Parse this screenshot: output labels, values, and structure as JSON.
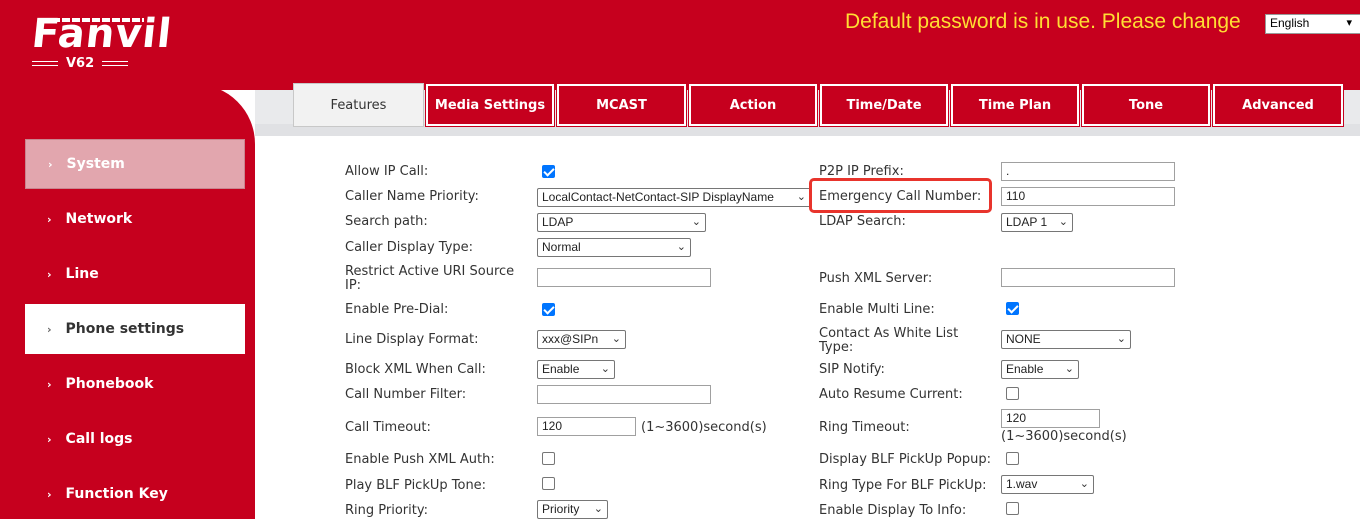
{
  "header": {
    "brand": "Fanvil",
    "model": "V62",
    "warning": "Default password is in use. Please change",
    "language": "English",
    "colors": {
      "brand_red": "#c6001e",
      "warning_yellow": "#ffde33"
    }
  },
  "sidebar": {
    "items": [
      {
        "label": "System",
        "icon": "chevron-right-icon"
      },
      {
        "label": "Network",
        "icon": "chevron-right-icon"
      },
      {
        "label": "Line",
        "icon": "chevron-right-icon"
      },
      {
        "label": "Phone settings",
        "icon": "chevron-right-icon"
      },
      {
        "label": "Phonebook",
        "icon": "chevron-right-icon"
      },
      {
        "label": "Call logs",
        "icon": "chevron-right-icon"
      },
      {
        "label": "Function Key",
        "icon": "chevron-right-icon"
      }
    ]
  },
  "tabs": [
    {
      "label": "Features",
      "active": true
    },
    {
      "label": "Media Settings"
    },
    {
      "label": "MCAST"
    },
    {
      "label": "Action"
    },
    {
      "label": "Time/Date"
    },
    {
      "label": "Time Plan"
    },
    {
      "label": "Tone"
    },
    {
      "label": "Advanced"
    }
  ],
  "left": {
    "allow_ip_call": {
      "label": "Allow IP Call:",
      "checked": true
    },
    "caller_name_priority": {
      "label": "Caller Name Priority:",
      "value": "LocalContact-NetContact-SIP DisplayName"
    },
    "search_path": {
      "label": "Search path:",
      "value": "LDAP"
    },
    "caller_display_type": {
      "label": "Caller Display Type:",
      "value": "Normal"
    },
    "restrict_uri_1": "Restrict Active URI Source",
    "restrict_uri_2": "IP:",
    "restrict_uri_value": "",
    "enable_pre_dial": {
      "label": "Enable Pre-Dial:",
      "checked": true
    },
    "line_display_format": {
      "label": "Line Display Format:",
      "value": "xxx@SIPn"
    },
    "block_xml": {
      "label": "Block XML When Call:",
      "value": "Enable"
    },
    "call_number_filter": {
      "label": "Call Number Filter:",
      "value": ""
    },
    "call_timeout": {
      "label": "Call Timeout:",
      "value": "120",
      "unit": "(1~3600)second(s)"
    },
    "push_xml_auth": {
      "label": "Enable Push XML Auth:",
      "checked": false
    },
    "blf_pickup_tone": {
      "label": "Play BLF PickUp Tone:",
      "checked": false
    },
    "ring_priority": {
      "label": "Ring Priority:",
      "value": "Priority"
    }
  },
  "right": {
    "p2p_ip_prefix": {
      "label": "P2P IP Prefix:",
      "value": "."
    },
    "emergency_call_number": {
      "label": "Emergency Call Number:",
      "value": "110"
    },
    "ldap_search": {
      "label": "LDAP Search:",
      "value": "LDAP 1"
    },
    "push_xml_server": {
      "label": "Push XML Server:",
      "value": ""
    },
    "enable_multi_line": {
      "label": "Enable Multi Line:",
      "checked": true
    },
    "contact_white_list_1": "Contact As White List",
    "contact_white_list_2": "Type:",
    "contact_white_list_value": "NONE",
    "sip_notify": {
      "label": "SIP Notify:",
      "value": "Enable"
    },
    "auto_resume": {
      "label": "Auto Resume Current:",
      "checked": false
    },
    "ring_timeout": {
      "label": "Ring Timeout:",
      "value": "120",
      "unit": "(1~3600)second(s)"
    },
    "blf_pickup_popup": {
      "label": "Display BLF PickUp Popup:",
      "checked": false
    },
    "ring_type_blf": {
      "label": "Ring Type For BLF PickUp:",
      "value": "1.wav"
    },
    "display_to_info": {
      "label": "Enable Display To Info:",
      "checked": false
    }
  }
}
